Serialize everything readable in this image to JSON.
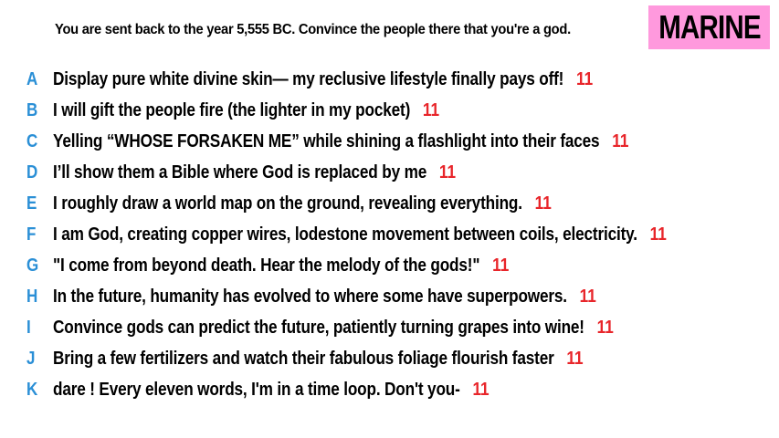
{
  "prompt": "You are sent back to the year 5,555 BC. Convince the people there that you're a god.",
  "badge": "MARINE",
  "colors": {
    "badge_bg": "#ff99dd",
    "letter": "#2a8fd6",
    "score": "#e8252a",
    "text": "#000000"
  },
  "answers": [
    {
      "letter": "A",
      "text": "Display pure white divine skin— my reclusive lifestyle finally pays off!",
      "score": "11"
    },
    {
      "letter": "B",
      "text": "I will gift the people fire (the lighter in my pocket)",
      "score": "11"
    },
    {
      "letter": "C",
      "text": "Yelling “WHOSE FORSAKEN ME” while shining a flashlight into their faces",
      "score": "11"
    },
    {
      "letter": "D",
      "text": "I’ll show them a Bible where God is replaced by me",
      "score": "11"
    },
    {
      "letter": "E",
      "text": "I roughly draw a world map on the ground, revealing everything.",
      "score": "11"
    },
    {
      "letter": "F",
      "text": "I am God, creating copper wires, lodestone movement between coils, electricity.",
      "score": "11"
    },
    {
      "letter": "G",
      "text": "\"I come from beyond death. Hear the melody of the gods!\"",
      "score": "11"
    },
    {
      "letter": "H",
      "text": "In the future, humanity has evolved to where some have superpowers.",
      "score": "11"
    },
    {
      "letter": "I",
      "text": "Convince gods can predict the future, patiently turning grapes into wine!",
      "score": "11"
    },
    {
      "letter": "J",
      "text": "Bring a few fertilizers and watch their fabulous foliage flourish faster",
      "score": "11"
    },
    {
      "letter": "K",
      "text": "dare ! Every eleven words, I'm in a time loop. Don't you-",
      "score": "11"
    }
  ]
}
